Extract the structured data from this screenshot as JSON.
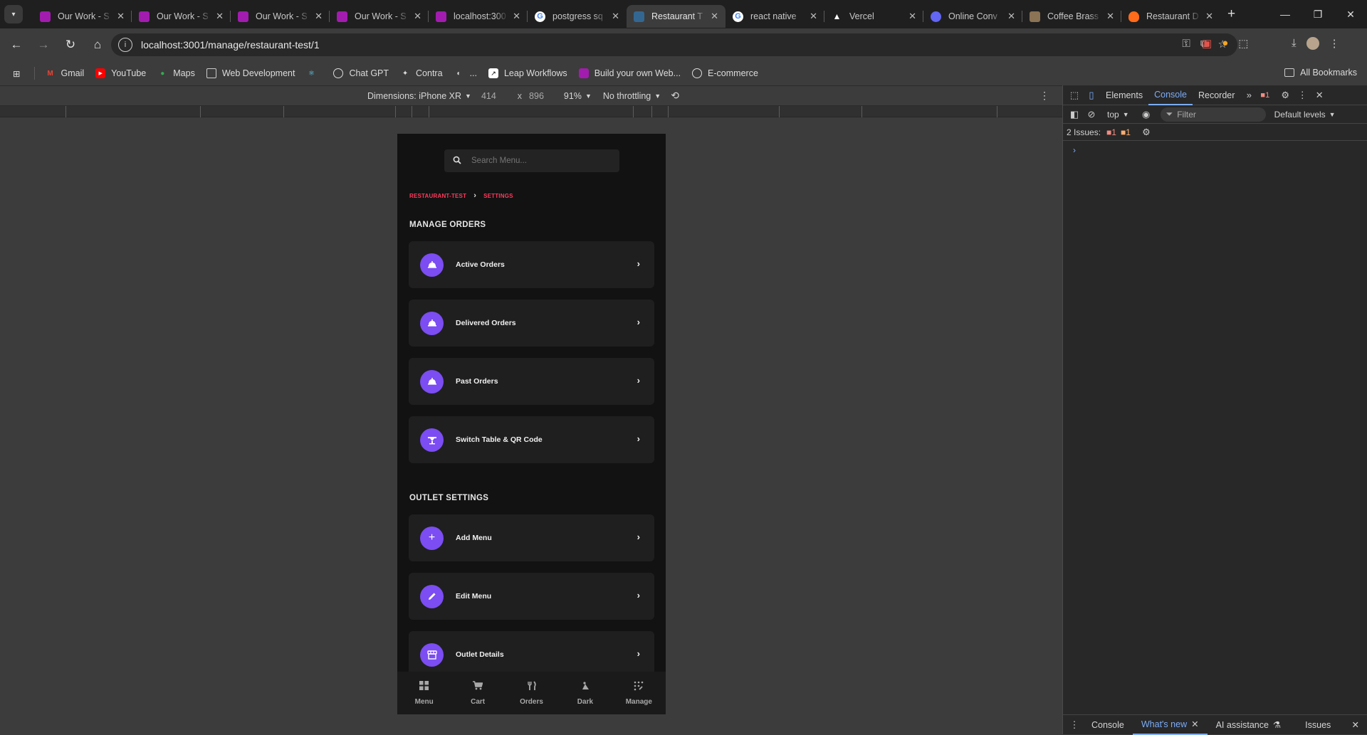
{
  "tabs": [
    {
      "title": "Our Work - S",
      "fav": "#a21caf",
      "active": false
    },
    {
      "title": "Our Work - S",
      "fav": "#a21caf",
      "active": false
    },
    {
      "title": "Our Work - S",
      "fav": "#a21caf",
      "active": false
    },
    {
      "title": "Our Work - S",
      "fav": "#a21caf",
      "active": false
    },
    {
      "title": "localhost:300",
      "fav": "#a21caf",
      "active": false
    },
    {
      "title": "postgress sq",
      "fav": "#4285f4",
      "active": false
    },
    {
      "title": "Restaurant T",
      "fav": "#336791",
      "active": true
    },
    {
      "title": "react native",
      "fav": "#4285f4",
      "active": false
    },
    {
      "title": "Vercel",
      "fav": "#000000",
      "active": false
    },
    {
      "title": "Online Conv",
      "fav": "#6366f1",
      "active": false
    },
    {
      "title": "Coffee Brass",
      "fav": "#8b7355",
      "active": false
    },
    {
      "title": "Restaurant D",
      "fav": "#ff6b1a",
      "active": false
    }
  ],
  "address": {
    "url": "localhost:3001/manage/restaurant-test/1"
  },
  "bookmarks": [
    "Gmail",
    "YouTube",
    "Maps",
    "Web Development",
    "",
    "Chat GPT",
    "Contra",
    "...",
    "Leap Workflows",
    "Build your own Web...",
    "E-commerce"
  ],
  "all_bookmarks": "All Bookmarks",
  "device": {
    "dimensions": "Dimensions: iPhone XR",
    "width": "414",
    "times": "x",
    "height": "896",
    "zoom": "91%",
    "throttle": "No throttling"
  },
  "app": {
    "search_placeholder": "Search Menu...",
    "crumb1": "RESTAURANT-TEST",
    "crumb2": "SETTINGS",
    "section1": "MANAGE ORDERS",
    "section2": "OUTLET SETTINGS",
    "cards": [
      "Active Orders",
      "Delivered Orders",
      "Past Orders",
      "Switch Table & QR Code",
      "Add Menu",
      "Edit Menu",
      "Outlet Details"
    ],
    "nav": [
      "Menu",
      "Cart",
      "Orders",
      "Dark",
      "Manage"
    ]
  },
  "devtools": {
    "tabs": [
      "Elements",
      "Console",
      "Recorder"
    ],
    "error_count": "1",
    "context": "top",
    "filter": "Filter",
    "levels": "Default levels",
    "issues_label": "2 Issues:",
    "issues_red": "1",
    "issues_orange": "1",
    "drawer": [
      "Console",
      "What's new",
      "AI assistance",
      "Issues"
    ]
  },
  "colors": {
    "accent": "#7b4df2",
    "crumb": "#ff3b5c",
    "devtools_blue": "#7cacf8"
  }
}
